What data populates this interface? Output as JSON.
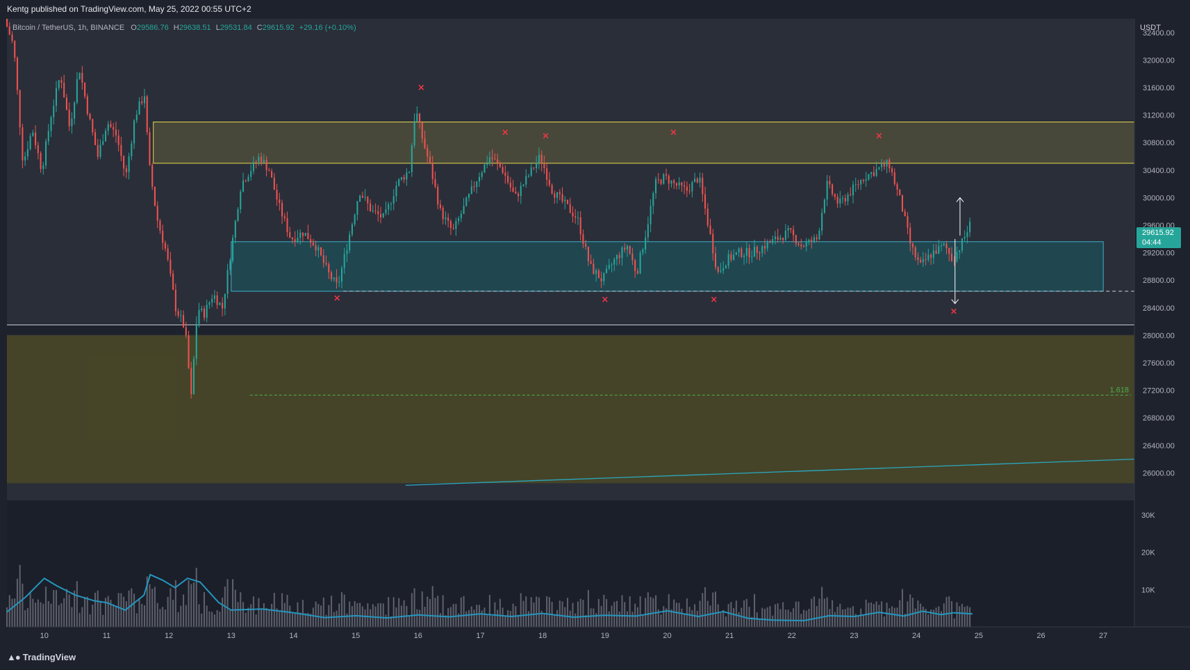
{
  "header": {
    "published_text": "Kentg published on TradingView.com, May 25, 2022 00:55 UTC+2"
  },
  "legend": {
    "symbol": "Bitcoin / TetherUS, 1h, BINANCE",
    "open_label": "O",
    "open": "29586.76",
    "high_label": "H",
    "high": "29638.51",
    "low_label": "L",
    "low": "29531.84",
    "close_label": "C",
    "close": "29615.92",
    "change": "+29.16 (+0.10%)"
  },
  "price_badge": {
    "price": "29615.92",
    "countdown": "04:44"
  },
  "footer": {
    "logo_text": "TradingView"
  },
  "colors": {
    "background": "#1e222d",
    "up": "#26a69a",
    "down": "#ef5350",
    "resistance_zone": "#4a4a3a",
    "support_zone": "#1f4a55",
    "lower_zone": "#474627",
    "marker": "#f23645",
    "fib": "#4caf50",
    "trendline": "#2aa9c2",
    "volume_ma": "#2596be"
  },
  "chart_data": {
    "type": "candlestick",
    "symbol": "Bitcoin / TetherUS",
    "interval": "1h",
    "exchange": "BINANCE",
    "currency_label": "USDT",
    "ylim": [
      25600,
      32600
    ],
    "y_ticks": [
      32400,
      32000,
      31600,
      31200,
      30800,
      30400,
      30000,
      29600,
      29200,
      28800,
      28400,
      28000,
      27600,
      27200,
      26800,
      26400,
      26000
    ],
    "y_tick_labels": [
      "32400.00",
      "32000.00",
      "31600.00",
      "31200.00",
      "30800.00",
      "30400.00",
      "30000.00",
      "29600.00",
      "29200.00",
      "28800.00",
      "28400.00",
      "28000.00",
      "27600.00",
      "27200.00",
      "26800.00",
      "26400.00",
      "26000.00"
    ],
    "x_range_days": [
      9.4,
      27.5
    ],
    "x_ticks": [
      "10",
      "11",
      "12",
      "13",
      "14",
      "15",
      "16",
      "17",
      "18",
      "19",
      "20",
      "21",
      "22",
      "23",
      "24",
      "25",
      "26",
      "27"
    ],
    "price_path": [
      [
        9.4,
        32600
      ],
      [
        9.55,
        32200
      ],
      [
        9.7,
        30500
      ],
      [
        9.85,
        31000
      ],
      [
        10.0,
        30400
      ],
      [
        10.15,
        31200
      ],
      [
        10.3,
        31800
      ],
      [
        10.45,
        31000
      ],
      [
        10.6,
        31900
      ],
      [
        10.75,
        31200
      ],
      [
        10.9,
        30600
      ],
      [
        11.05,
        31100
      ],
      [
        11.2,
        30900
      ],
      [
        11.35,
        30300
      ],
      [
        11.5,
        31200
      ],
      [
        11.65,
        31500
      ],
      [
        11.72,
        30500
      ],
      [
        11.85,
        29700
      ],
      [
        12.0,
        29200
      ],
      [
        12.15,
        28400
      ],
      [
        12.3,
        28100
      ],
      [
        12.4,
        27100
      ],
      [
        12.5,
        28400
      ],
      [
        12.6,
        28300
      ],
      [
        12.75,
        28600
      ],
      [
        12.9,
        28400
      ],
      [
        13.05,
        29300
      ],
      [
        13.2,
        30200
      ],
      [
        13.35,
        30400
      ],
      [
        13.5,
        30600
      ],
      [
        13.65,
        30400
      ],
      [
        13.8,
        29900
      ],
      [
        14.0,
        29400
      ],
      [
        14.2,
        29500
      ],
      [
        14.4,
        29300
      ],
      [
        14.6,
        28900
      ],
      [
        14.75,
        28700
      ],
      [
        14.9,
        29300
      ],
      [
        15.1,
        30100
      ],
      [
        15.3,
        29800
      ],
      [
        15.5,
        29700
      ],
      [
        15.7,
        30200
      ],
      [
        15.9,
        30400
      ],
      [
        16.0,
        31300
      ],
      [
        16.1,
        30900
      ],
      [
        16.25,
        30400
      ],
      [
        16.4,
        29800
      ],
      [
        16.6,
        29500
      ],
      [
        16.8,
        29900
      ],
      [
        17.0,
        30300
      ],
      [
        17.2,
        30600
      ],
      [
        17.4,
        30400
      ],
      [
        17.6,
        30000
      ],
      [
        17.8,
        30300
      ],
      [
        18.0,
        30600
      ],
      [
        18.2,
        30100
      ],
      [
        18.4,
        29900
      ],
      [
        18.6,
        29700
      ],
      [
        18.8,
        29000
      ],
      [
        19.0,
        28800
      ],
      [
        19.2,
        29100
      ],
      [
        19.4,
        29300
      ],
      [
        19.55,
        28900
      ],
      [
        19.7,
        29500
      ],
      [
        19.85,
        30200
      ],
      [
        20.0,
        30300
      ],
      [
        20.15,
        30200
      ],
      [
        20.35,
        30100
      ],
      [
        20.55,
        30300
      ],
      [
        20.7,
        29600
      ],
      [
        20.85,
        28900
      ],
      [
        21.0,
        29100
      ],
      [
        21.2,
        29200
      ],
      [
        21.4,
        29200
      ],
      [
        21.6,
        29300
      ],
      [
        21.8,
        29400
      ],
      [
        22.0,
        29500
      ],
      [
        22.2,
        29300
      ],
      [
        22.45,
        29400
      ],
      [
        22.6,
        30200
      ],
      [
        22.8,
        29900
      ],
      [
        23.0,
        30100
      ],
      [
        23.2,
        30300
      ],
      [
        23.4,
        30400
      ],
      [
        23.6,
        30500
      ],
      [
        23.8,
        29900
      ],
      [
        23.95,
        29300
      ],
      [
        24.1,
        29000
      ],
      [
        24.3,
        29200
      ],
      [
        24.5,
        29300
      ],
      [
        24.62,
        29100
      ],
      [
        24.75,
        29300
      ],
      [
        24.9,
        29600
      ]
    ],
    "zones": [
      {
        "name": "resistance",
        "from": 30500,
        "to": 31100,
        "x_start": 11.75,
        "x_end": 27.5
      },
      {
        "name": "support",
        "from": 28640,
        "to": 29360,
        "x_start": 13.0,
        "x_end": 27.0
      },
      {
        "name": "lower",
        "from": 25850,
        "to": 28000,
        "x_start": 9.4,
        "x_end": 27.5
      }
    ],
    "horizontal_lines": [
      {
        "name": "support-dashed",
        "value": 28640,
        "style": "dashed"
      },
      {
        "name": "fib-1.618",
        "value": 27130,
        "style": "dashed",
        "label": "1.618"
      },
      {
        "name": "black-line",
        "value": 28150,
        "style": "solid"
      }
    ],
    "trendline": [
      [
        15.8,
        25820
      ],
      [
        27.5,
        26200
      ]
    ],
    "markers": [
      [
        14.7,
        28540
      ],
      [
        16.05,
        31600
      ],
      [
        17.4,
        30950
      ],
      [
        18.05,
        30900
      ],
      [
        19.0,
        28520
      ],
      [
        20.1,
        30950
      ],
      [
        20.75,
        28520
      ],
      [
        23.4,
        30900
      ],
      [
        24.6,
        28350
      ]
    ],
    "arrows": [
      {
        "name": "target-up",
        "x": 24.7,
        "from": 29450,
        "to": 30000
      },
      {
        "name": "target-down",
        "x": 24.62,
        "from": 29400,
        "to": 28460
      }
    ],
    "volume": {
      "y_ticks": [
        30000,
        20000,
        10000
      ],
      "y_tick_labels": [
        "30K",
        "20K",
        "10K"
      ],
      "ylim": [
        0,
        32000
      ],
      "ma_path": [
        [
          9.4,
          4000
        ],
        [
          9.7,
          8000
        ],
        [
          10.0,
          13000
        ],
        [
          10.2,
          11000
        ],
        [
          10.5,
          8500
        ],
        [
          10.8,
          7000
        ],
        [
          11.0,
          6500
        ],
        [
          11.3,
          4500
        ],
        [
          11.6,
          8500
        ],
        [
          11.7,
          14000
        ],
        [
          11.9,
          12500
        ],
        [
          12.1,
          10500
        ],
        [
          12.3,
          13000
        ],
        [
          12.5,
          12000
        ],
        [
          12.8,
          6500
        ],
        [
          13.0,
          4500
        ],
        [
          13.5,
          4800
        ],
        [
          14.0,
          3800
        ],
        [
          14.5,
          2500
        ],
        [
          15.0,
          3000
        ],
        [
          15.5,
          2400
        ],
        [
          16.0,
          3200
        ],
        [
          16.5,
          2700
        ],
        [
          17.0,
          3500
        ],
        [
          17.5,
          2800
        ],
        [
          18.0,
          3600
        ],
        [
          18.5,
          2600
        ],
        [
          19.0,
          3100
        ],
        [
          19.5,
          2900
        ],
        [
          20.0,
          4300
        ],
        [
          20.5,
          2800
        ],
        [
          20.9,
          4100
        ],
        [
          21.3,
          2300
        ],
        [
          21.7,
          1800
        ],
        [
          22.2,
          1700
        ],
        [
          22.6,
          3000
        ],
        [
          23.0,
          2800
        ],
        [
          23.4,
          3900
        ],
        [
          23.8,
          2900
        ],
        [
          24.1,
          4200
        ],
        [
          24.4,
          3300
        ],
        [
          24.6,
          3800
        ],
        [
          24.9,
          3500
        ]
      ]
    },
    "legend_values": {
      "open": 29586.76,
      "high": 29638.51,
      "low": 29531.84,
      "close": 29615.92,
      "change": 29.16,
      "change_pct": 0.1
    }
  }
}
